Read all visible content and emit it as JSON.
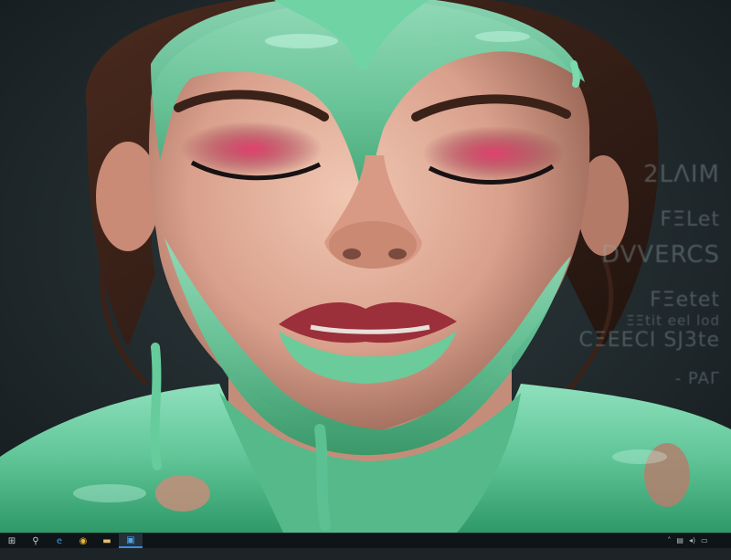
{
  "wallpaper": {
    "subject": "portrait-with-green-paint",
    "background_text_lines": [
      "2LΛIM",
      "FΞLet",
      "DVVERCS",
      "FΞetet",
      "ΞΞtit eel lod",
      "CΞEECI SJ3te",
      "- PAΓ"
    ]
  },
  "taskbar": {
    "items": [
      {
        "name": "start-button",
        "icon": "windows-logo-icon",
        "glyph": "⊞"
      },
      {
        "name": "search-button",
        "icon": "search-icon",
        "glyph": "⚲"
      },
      {
        "name": "edge-button",
        "icon": "edge-icon",
        "glyph": "e"
      },
      {
        "name": "chrome-button",
        "icon": "chrome-icon",
        "glyph": "◉"
      },
      {
        "name": "file-explorer-button",
        "icon": "folder-icon",
        "glyph": "▬"
      },
      {
        "name": "store-button",
        "icon": "store-icon",
        "glyph": "▣"
      }
    ],
    "tray": [
      {
        "icon": "chevron-up-icon",
        "glyph": "˄"
      },
      {
        "icon": "network-icon",
        "glyph": "▤"
      },
      {
        "icon": "volume-icon",
        "glyph": "◂)"
      },
      {
        "icon": "battery-icon",
        "glyph": "▭"
      }
    ],
    "clock": {
      "time": "",
      "date": ""
    },
    "accent_color": "#3b8be0",
    "background_color": "#0f1418"
  }
}
